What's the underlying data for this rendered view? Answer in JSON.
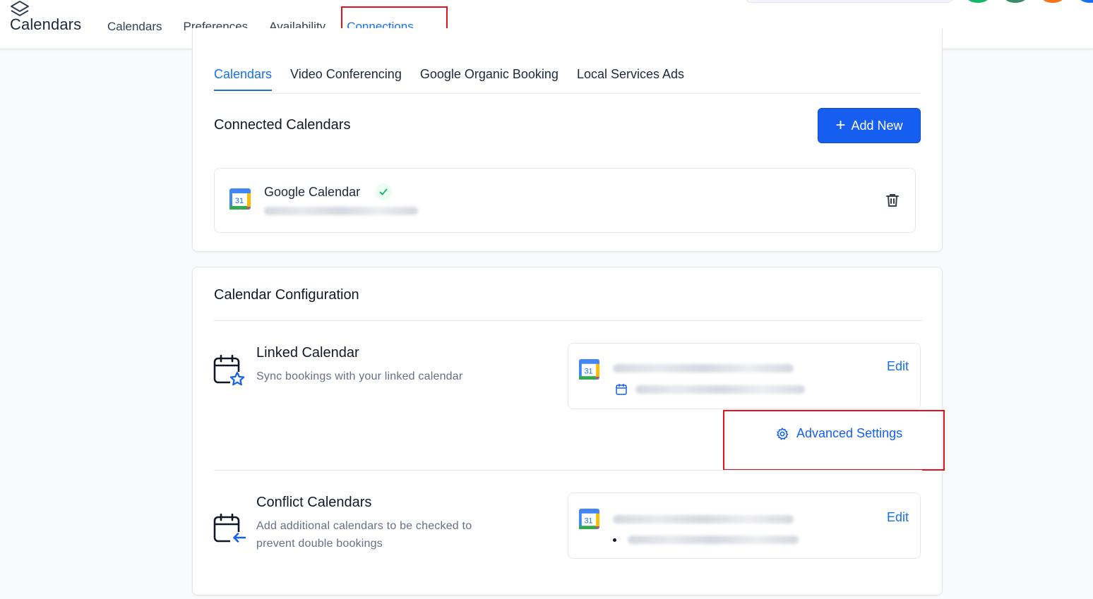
{
  "app": {
    "title": "Calendars"
  },
  "topnav": {
    "items": [
      {
        "label": "Calendars",
        "active": false
      },
      {
        "label": "Preferences",
        "active": false
      },
      {
        "label": "Availability",
        "active": false
      },
      {
        "label": "Connections",
        "active": true
      }
    ]
  },
  "subtabs": {
    "items": [
      {
        "label": "Calendars",
        "active": true
      },
      {
        "label": "Video Conferencing",
        "active": false
      },
      {
        "label": "Google Organic Booking",
        "active": false
      },
      {
        "label": "Local Services Ads",
        "active": false
      }
    ]
  },
  "connected": {
    "title": "Connected Calendars",
    "add_button": "Add New",
    "calendars": [
      {
        "name": "Google Calendar",
        "icon": "google-calendar-icon",
        "icon_number": "31",
        "status": "connected"
      }
    ]
  },
  "configuration": {
    "title": "Calendar Configuration",
    "linked": {
      "title": "Linked Calendar",
      "description": "Sync bookings with your linked calendar",
      "edit_label": "Edit",
      "icon_number": "31"
    },
    "advanced_settings": "Advanced Settings",
    "conflict": {
      "title": "Conflict Calendars",
      "description_line1": "Add additional calendars to be checked to",
      "description_line2": "prevent double bookings",
      "edit_label": "Edit",
      "icon_number": "31"
    }
  },
  "colors": {
    "accent": "#155eef",
    "link": "#1570ef",
    "highlight": "#e1121a",
    "success": "#12b76a"
  }
}
